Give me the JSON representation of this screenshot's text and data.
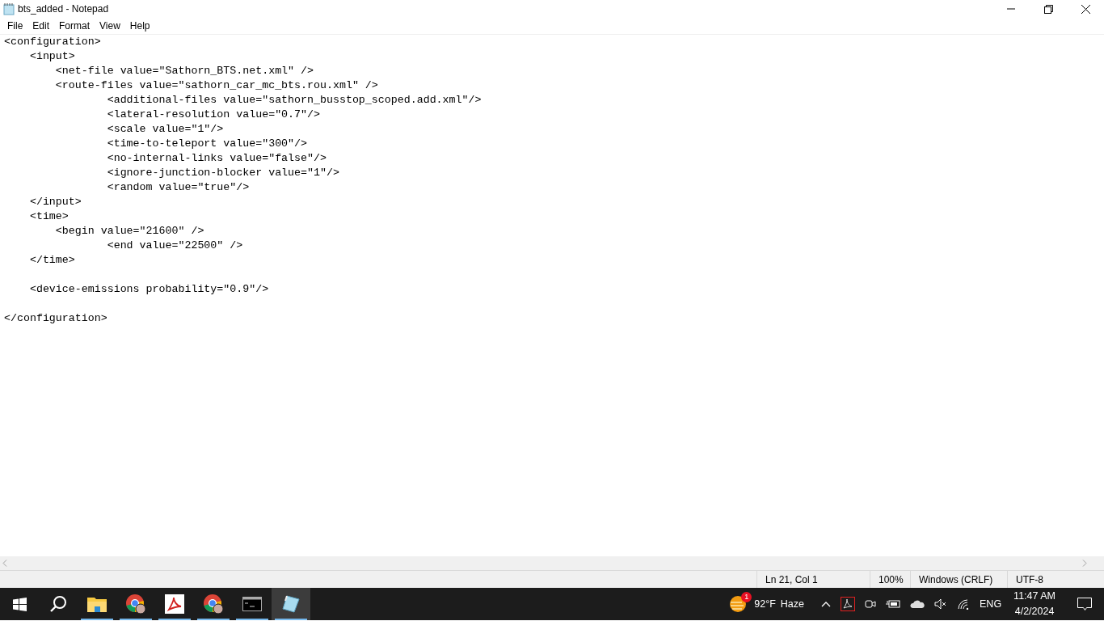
{
  "window": {
    "title": "bts_added - Notepad"
  },
  "menu": [
    "File",
    "Edit",
    "Format",
    "View",
    "Help"
  ],
  "editor": {
    "content": "<configuration>\n    <input>\n        <net-file value=\"Sathorn_BTS.net.xml\" />\n        <route-files value=\"sathorn_car_mc_bts.rou.xml\" />\n                <additional-files value=\"sathorn_busstop_scoped.add.xml\"/>\n                <lateral-resolution value=\"0.7\"/>\n                <scale value=\"1\"/>\n                <time-to-teleport value=\"300\"/>\n                <no-internal-links value=\"false\"/>\n                <ignore-junction-blocker value=\"1\"/>\n                <random value=\"true\"/>\n    </input>\n    <time>\n        <begin value=\"21600\" />\n                <end value=\"22500\" />\n    </time>\n\n    <device-emissions probability=\"0.9\"/>\n\n</configuration>"
  },
  "status_bar": [
    "Ln 21, Col 1",
    "100%",
    "Windows (CRLF)",
    "UTF-8"
  ],
  "taskbar": {
    "apps": [
      {
        "kind": "start",
        "running": false,
        "selected": false
      },
      {
        "kind": "search",
        "running": false,
        "selected": false
      },
      {
        "kind": "explorer",
        "running": true,
        "selected": false
      },
      {
        "kind": "browser",
        "running": true,
        "selected": false
      },
      {
        "kind": "pdf",
        "running": true,
        "selected": false
      },
      {
        "kind": "browser",
        "running": true,
        "selected": false
      },
      {
        "kind": "terminal",
        "running": true,
        "selected": false
      },
      {
        "kind": "notepad",
        "running": true,
        "selected": true
      }
    ],
    "weather": {
      "badge": "1",
      "temperature": "92°F",
      "condition": "Haze"
    },
    "tray": {
      "language": "ENG",
      "time": "11:47 AM",
      "date": "4/2/2024"
    }
  }
}
